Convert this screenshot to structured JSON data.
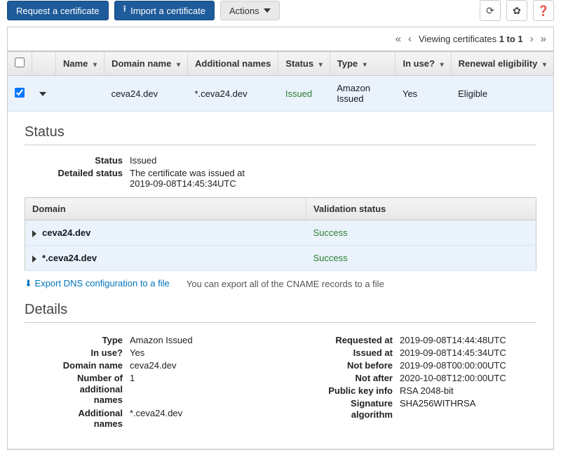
{
  "toolbar": {
    "request": "Request a certificate",
    "import": "Import a certificate",
    "actions": "Actions"
  },
  "pager": {
    "text_prefix": "Viewing certificates ",
    "range": "1 to 1"
  },
  "columns": {
    "name": "Name",
    "domain": "Domain name",
    "additional": "Additional names",
    "status": "Status",
    "type": "Type",
    "inuse": "In use?",
    "renewal": "Renewal eligibility"
  },
  "row": {
    "name": "",
    "domain": "ceva24.dev",
    "additional": "*.ceva24.dev",
    "status": "Issued",
    "type": "Amazon Issued",
    "inuse": "Yes",
    "renewal": "Eligible"
  },
  "status_section": {
    "title": "Status",
    "status_k": "Status",
    "status_v": "Issued",
    "detailed_k": "Detailed status",
    "detailed_v1": "The certificate was issued at",
    "detailed_v2": "2019-09-08T14:45:34UTC",
    "domain_h": "Domain",
    "validation_h": "Validation status",
    "domains": [
      {
        "name": "ceva24.dev",
        "status": "Success"
      },
      {
        "name": "*.ceva24.dev",
        "status": "Success"
      }
    ],
    "export_link": "Export DNS configuration to a file",
    "export_hint": "You can export all of the CNAME records to a file"
  },
  "details_section": {
    "title": "Details",
    "left": {
      "type_k": "Type",
      "type_v": "Amazon Issued",
      "inuse_k": "In use?",
      "inuse_v": "Yes",
      "domain_k": "Domain name",
      "domain_v": "ceva24.dev",
      "num_k1": "Number of",
      "num_k2": "additional",
      "num_k3": "names",
      "num_v": "1",
      "add_k1": "Additional",
      "add_k2": "names",
      "add_v": "*.ceva24.dev"
    },
    "right": {
      "requested_k": "Requested at",
      "requested_v": "2019-09-08T14:44:48UTC",
      "issued_k": "Issued at",
      "issued_v": "2019-09-08T14:45:34UTC",
      "notbefore_k": "Not before",
      "notbefore_v": "2019-09-08T00:00:00UTC",
      "notafter_k": "Not after",
      "notafter_v": "2020-10-08T12:00:00UTC",
      "pki_k": "Public key info",
      "pki_v": "RSA 2048-bit",
      "sig_k1": "Signature",
      "sig_k2": "algorithm",
      "sig_v": "SHA256WITHRSA"
    }
  }
}
